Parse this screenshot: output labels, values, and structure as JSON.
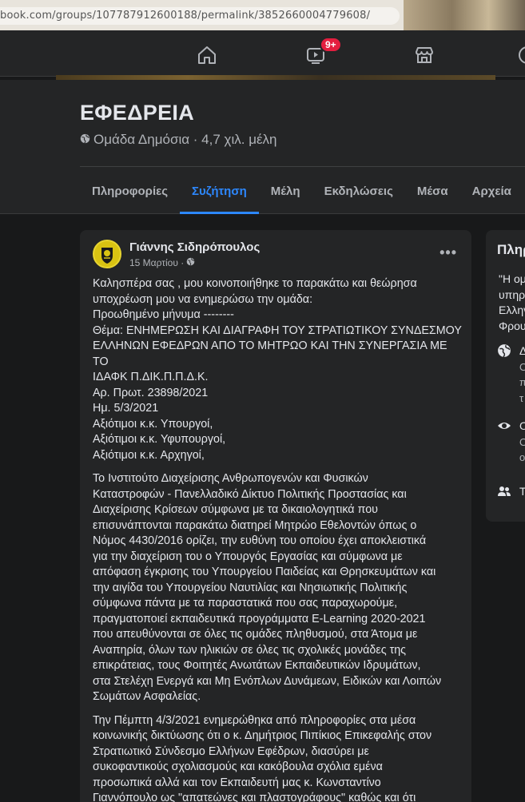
{
  "browser": {
    "url": "book.com/groups/107787912600188/permalink/3852660004779608/"
  },
  "topnav": {
    "watch_badge": "9+"
  },
  "group": {
    "name": "ΕΦΕΔΡΕΙΑ",
    "meta": "Ομάδα Δημόσια · 4,7 χιλ. μέλη",
    "tabs": [
      "Πληροφορίες",
      "Συζήτηση",
      "Μέλη",
      "Εκδηλώσεις",
      "Μέσα",
      "Αρχεία"
    ],
    "active_tab": "Συζήτηση"
  },
  "post": {
    "author": "Γιάννης Σιδηρόπουλος",
    "date": "15 Μαρτίου ·",
    "more": "•••",
    "paragraph1": [
      "Καλησπέρα σας , μου κοινοποιήθηκε το παρακάτω και θεώρησα",
      "υποχρέωση μου να ενημερώσω την ομάδα:",
      "Προωθημένο μήνυμα --------",
      "Θέμα: ΕΝΗΜΕΡΩΣΗ ΚΑΙ ΔΙΑΓΡΑΦΗ ΤΟΥ ΣΤΡΑΤΙΩΤΙΚΟΥ ΣΥΝΔΕΣΜΟΥ",
      "ΕΛΛΗΝΩΝ ΕΦΕΔΡΩΝ ΑΠΟ ΤΟ ΜΗΤΡΩΟ ΚΑΙ ΤΗΝ ΣΥΝΕΡΓΑΣΙΑ ΜΕ ΤΟ",
      "ΙΔΑΦΚ Π.ΔΙΚ.Π.Π.Δ.Κ.",
      "Αρ. Πρωτ. 23898/2021",
      "Ημ. 5/3/2021",
      "Αξιότιμοι κ.κ. Υπουργοί,",
      "Αξιότιμοι κ.κ. Υφυπουργοί,",
      "Αξιότιμοι κ.κ. Αρχηγοί,"
    ],
    "paragraph2": [
      "Το Ινστιτούτο Διαχείρισης Ανθρωπογενών και Φυσικών",
      "Καταστροφών - Πανελλαδικό Δίκτυο Πολιτικής Προστασίας και",
      "Διαχείρισης Κρίσεων σύμφωνα με τα δικαιολογητικά που",
      "επισυνάπτονται παρακάτω διατηρεί Μητρώο Εθελοντών όπως ο",
      "Νόμος 4430/2016 ορίζει, την ευθύνη του οποίου έχει αποκλειστικά",
      "για την διαχείριση του ο Υπουργός Εργασίας και σύμφωνα με",
      "απόφαση έγκρισης του Υπουργείου Παιδείας και Θρησκευμάτων και",
      "την αιγίδα του Υπουργείου Ναυτιλίας και Νησιωτικής Πολιτικής",
      "σύμφωνα πάντα με τα παραστατικά που σας παραχωρούμε,",
      "πραγματοποιεί εκπαιδευτικά προγράμματα E-Learning 2020-2021",
      "που απευθύνονται  σε όλες τις ομάδες πληθυσμού, στα Άτομα με",
      "Αναπηρία, όλων των ηλικιών σε όλες τις σχολικές μονάδες της",
      "επικράτειας, τους Φοιτητές Ανωτάτων Εκπαιδευτικών Ιδρυμάτων,",
      "στα Στελέχη Ενεργά και Μη Ενόπλων Δυνάμεων, Ειδικών και Λοιπών",
      "Σωμάτων Ασφαλείας."
    ],
    "paragraph3": [
      "Την Πέμπτη 4/3/2021 ενημερώθηκα από πληροφορίες στα μέσα",
      "κοινωνικής δικτύωσης ότι ο κ. Δημήτριος Πιπίκιος Επικεφαλής στον",
      "Στρατιωτικό Σύνδεσμο Ελλήνων Εφέδρων, διασύρει με",
      "συκοφαντικούς σχολιασμούς και κακόβουλα σχόλια εμένα",
      "προσωπικά αλλά και τον Εκπαιδευτή μας κ. Κωνσταντίνο",
      "Γιαννόπουλο ως \"απατεώνες και πλαστογράφους\"  καθώς και ότι",
      "\"θα μας κυνηγήσει μέχρι τον άλλο κόσμο\""
    ]
  },
  "sidebar": {
    "title": "Πληρ",
    "text_lines": [
      "\"Η ομ",
      "υπηρ",
      "Ελλην",
      "Φρου"
    ],
    "row1": [
      "Δ",
      "Ο",
      "π",
      "τ"
    ],
    "row2": [
      "Ο",
      "Ο",
      "ο"
    ],
    "row3": "Τ"
  }
}
